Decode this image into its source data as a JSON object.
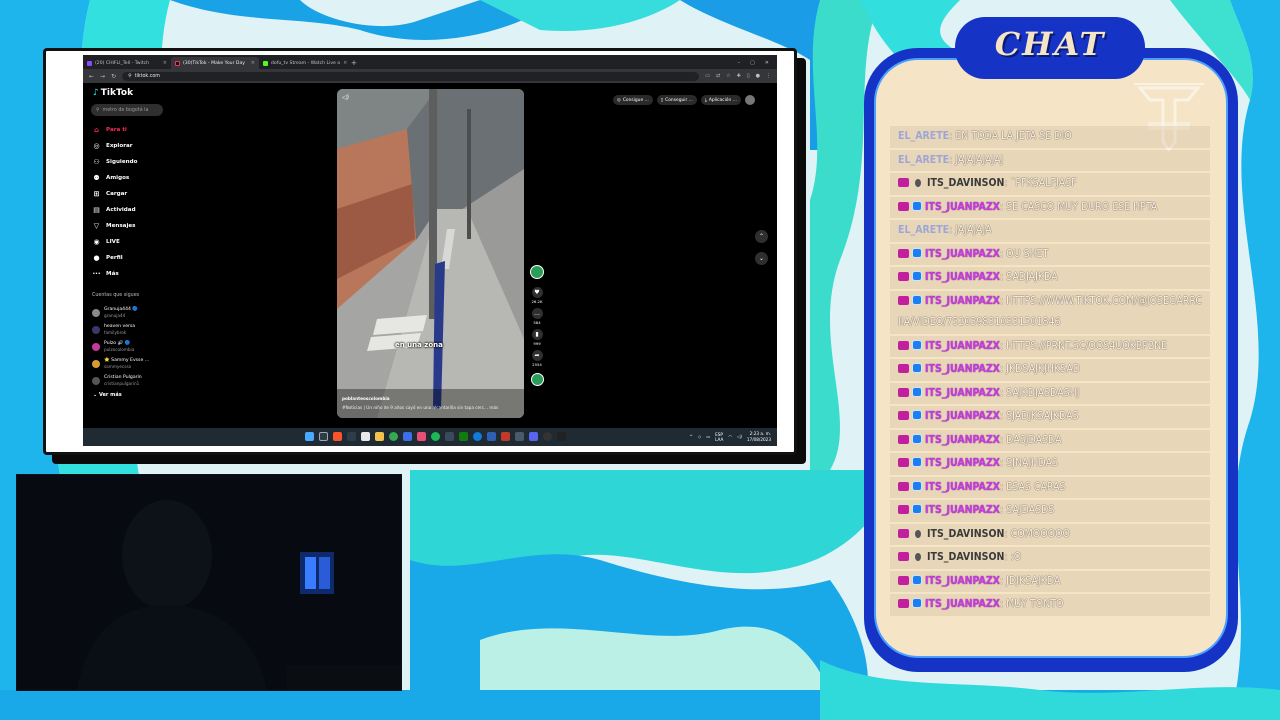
{
  "browser": {
    "tabs": [
      {
        "label": "(20) CHIFLI_Tell - Twitch",
        "icon_color": "#9146ff",
        "active": false
      },
      {
        "label": "(30)TikTok - Make Your Day",
        "icon_color": "#111111",
        "active": true
      },
      {
        "label": "dofu_tv Stream - Watch Live o",
        "icon_color": "#53fc18",
        "active": false
      }
    ],
    "new_tab": "+",
    "url": "tiktok.com"
  },
  "tiktok": {
    "logo": "TikTok",
    "search_placeholder": "metro de bogotá la",
    "nav": [
      {
        "label": "Para ti",
        "icon": "home-icon",
        "glyph": "⌂",
        "active": true
      },
      {
        "label": "Explorar",
        "icon": "compass-icon",
        "glyph": "◎",
        "active": false
      },
      {
        "label": "Siguiendo",
        "icon": "following-icon",
        "glyph": "⚇",
        "active": false
      },
      {
        "label": "Amigos",
        "icon": "friends-icon",
        "glyph": "⚉",
        "active": false
      },
      {
        "label": "Cargar",
        "icon": "upload-icon",
        "glyph": "⊞",
        "active": false
      },
      {
        "label": "Actividad",
        "icon": "activity-icon",
        "glyph": "▤",
        "active": false
      },
      {
        "label": "Mensajes",
        "icon": "messages-icon",
        "glyph": "▽",
        "active": false
      },
      {
        "label": "LIVE",
        "icon": "live-icon",
        "glyph": "◉",
        "active": false
      },
      {
        "label": "Perfil",
        "icon": "profile-icon",
        "glyph": "●",
        "active": false
      },
      {
        "label": "Más",
        "icon": "more-icon",
        "glyph": "···",
        "active": false
      }
    ],
    "following_title": "Cuentas que sigues",
    "following": [
      {
        "name": "Granuja444 🔵",
        "handle": "granuja44",
        "color": "#8a8a8a"
      },
      {
        "name": "heaven versa",
        "handle": "familybrok",
        "color": "#3a3a6a"
      },
      {
        "name": "Pulzo 🔊 🔵",
        "handle": "pulzocolombia",
        "color": "#c43c9b"
      },
      {
        "name": "⭐ Sammy Evsse ...",
        "handle": "sammyecsso",
        "color": "#d59b2f"
      },
      {
        "name": "Cristian Pulgarín",
        "handle": "cristianpulgarin1",
        "color": "#555555"
      }
    ],
    "ver_mas": "Ver más",
    "video": {
      "caption": "en una zona",
      "author": "poblanteoscolombia",
      "description": "#Noticias | Un niño de 9 años cayó en una alcantarilla sin tapa cerc... más"
    },
    "actions": [
      {
        "icon": "heart-icon",
        "glyph": "♥",
        "count": "26.2K"
      },
      {
        "icon": "comment-icon",
        "glyph": "…",
        "count": "584"
      },
      {
        "icon": "bookmark-icon",
        "glyph": "▮",
        "count": "999"
      },
      {
        "icon": "share-icon",
        "glyph": "➦",
        "count": "2554"
      }
    ],
    "top_buttons": [
      "Consigue ...",
      "Conseguir ...",
      "Aplicación ..."
    ]
  },
  "taskbar": {
    "lang": "ESP\nLAA",
    "time": "2:23 a. m.",
    "date": "17/08/2023"
  },
  "chat": {
    "title": "CHAT",
    "messages": [
      {
        "user": "EL_ARETE",
        "style": "light",
        "badges": [],
        "text": "EN TODA LA JETA SE DIO"
      },
      {
        "user": "EL_ARETE",
        "style": "light",
        "badges": [],
        "text": "JAJAJAJAJAJ"
      },
      {
        "user": "ITS_DAVINSON",
        "style": "dark",
        "badges": [
          "heart",
          "dot"
        ],
        "text": "¨PFKSALFJASF"
      },
      {
        "user": "ITS_JUANPAZX",
        "style": "purple",
        "badges": [
          "heart",
          "check"
        ],
        "text": "SE CASCO MUY DURO ESE HPTA"
      },
      {
        "user": "EL_ARETE",
        "style": "light",
        "badges": [],
        "text": "JAJAJAJA"
      },
      {
        "user": "ITS_JUANPAZX",
        "style": "purple",
        "badges": [
          "heart",
          "check"
        ],
        "text": "OU SHET"
      },
      {
        "user": "ITS_JUANPAZX",
        "style": "purple",
        "badges": [
          "heart",
          "check"
        ],
        "text": "SADJAJKDA"
      },
      {
        "user": "ITS_JUANPAZX",
        "style": "purple",
        "badges": [
          "heart",
          "check"
        ],
        "text": "HTTPS://WWW.TIKTOK.COM/@JOSEGARRCIIA/VIDEO/7520398310331501846"
      },
      {
        "user": "ITS_JUANPAZX",
        "style": "purple",
        "badges": [
          "heart",
          "check"
        ],
        "text": "HTTPS://PRNT.SC/OOS4UOKBP2NE"
      },
      {
        "user": "ITS_JUANPAZX",
        "style": "purple",
        "badges": [
          "heart",
          "check"
        ],
        "text": "JKDSAJKJHKSAD"
      },
      {
        "user": "ITS_JUANPAZX",
        "style": "purple",
        "badges": [
          "heart",
          "check"
        ],
        "text": "SAJKDJASDASHJ"
      },
      {
        "user": "ITS_JUANPAZX",
        "style": "purple",
        "badges": [
          "heart",
          "check"
        ],
        "text": "SJADJKSAJKDAS"
      },
      {
        "user": "ITS_JUANPAZX",
        "style": "purple",
        "badges": [
          "heart",
          "check"
        ],
        "text": "DASJDASDA"
      },
      {
        "user": "ITS_JUANPAZX",
        "style": "purple",
        "badges": [
          "heart",
          "check"
        ],
        "text": "SJNAJHDAS"
      },
      {
        "user": "ITS_JUANPAZX",
        "style": "purple",
        "badges": [
          "heart",
          "check"
        ],
        "text": "ESAS CARAS"
      },
      {
        "user": "ITS_JUANPAZX",
        "style": "purple",
        "badges": [
          "heart",
          "check"
        ],
        "text": "SAJDASDS"
      },
      {
        "user": "ITS_DAVINSON",
        "style": "dark",
        "badges": [
          "heart",
          "dot"
        ],
        "text": "COMOOOOO"
      },
      {
        "user": "ITS_DAVINSON",
        "style": "dark",
        "badges": [
          "heart",
          "dot"
        ],
        "text": ":O"
      },
      {
        "user": "ITS_JUANPAZX",
        "style": "purple",
        "badges": [
          "heart",
          "check"
        ],
        "text": "JDJKSAJKDA"
      },
      {
        "user": "ITS_JUANPAZX",
        "style": "purple",
        "badges": [
          "heart",
          "check"
        ],
        "text": "MUY TONTO"
      }
    ]
  },
  "colors": {
    "chat_border": "#1534c5",
    "chat_bg": "#f5e4c6",
    "accent_purple": "#c63be0",
    "tiktok_red": "#fe2c55"
  }
}
